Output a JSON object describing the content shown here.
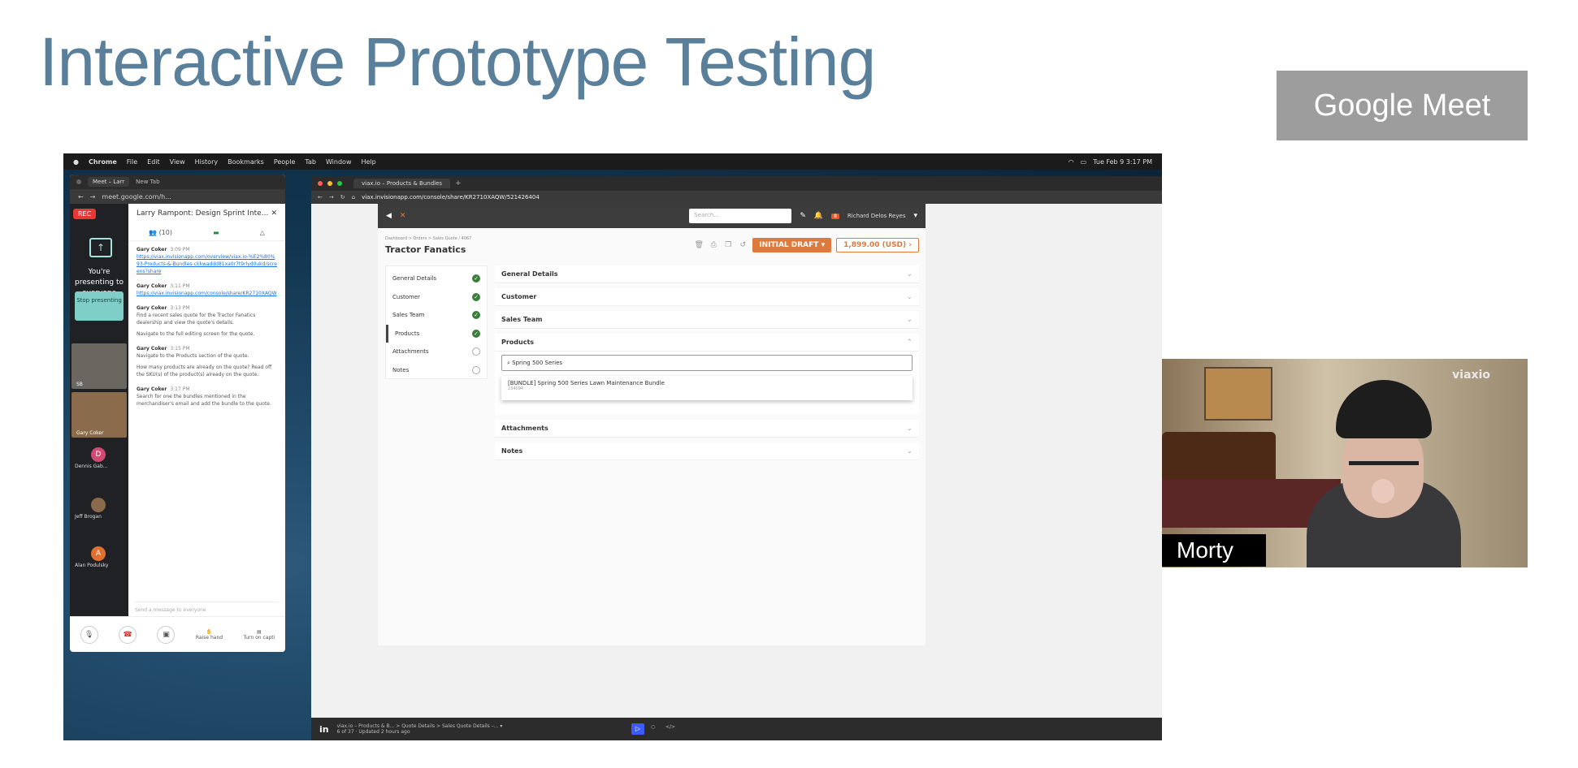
{
  "slide": {
    "title": "Interactive Prototype Testing",
    "badge": "Google Meet"
  },
  "mac_menu": {
    "items": [
      "Chrome",
      "File",
      "Edit",
      "View",
      "History",
      "Bookmarks",
      "People",
      "Tab",
      "Window",
      "Help"
    ],
    "clock": "Tue Feb 9 3:17 PM"
  },
  "meet": {
    "tab_label": "Meet – Larr",
    "new_tab": "New Tab",
    "url": "meet.google.com/h...",
    "rec": "REC",
    "presenting_text": "You're presenting to everyone",
    "stop_label": "Stop presenting",
    "chat_title": "Larry Rampont: Design Sprint Inte...",
    "participants_count": "(10)",
    "tiles": [
      {
        "name": "SB"
      },
      {
        "name": "Gary Coker"
      }
    ],
    "participants": [
      {
        "initial": "D",
        "name": "Dennis Gab...",
        "color": "#d14a72"
      },
      {
        "initial": "",
        "name": "Jeff Brogan",
        "color": "#8a6a4a"
      },
      {
        "initial": "A",
        "name": "Alan Podulsky",
        "color": "#e07030"
      }
    ],
    "messages": [
      {
        "who": "Gary Coker",
        "time": "3:09 PM",
        "text": "",
        "link": "https://viax.invisionapp.com/overview/viax.io-%E2%80%93-Products-&-Bundles-ckkwaddd81xa0r7t9rlyd0ukd/screens?share"
      },
      {
        "who": "Gary Coker",
        "time": "3:11 PM",
        "text": "",
        "link": "https://viax.invisionapp.com/console/share/KR2710XAQW"
      },
      {
        "who": "Gary Coker",
        "time": "3:13 PM",
        "text": "Find a recent sales quote for the Tractor Fanatics dealership and view the quote's details.",
        "text2": "Navigate to the full editing screen for the quote.",
        "link": ""
      },
      {
        "who": "Gary Coker",
        "time": "3:15 PM",
        "text": "Navigate to the Products section of the quote.",
        "text2": "How many products are already on the quote? Read off the SKU(s) of the product(s) already on the quote.",
        "link": ""
      },
      {
        "who": "Gary Coker",
        "time": "3:17 PM",
        "text": "Search for one the bundles mentioned in the merchandiser's email and add the bundle to the quote.",
        "link": ""
      }
    ],
    "input_placeholder": "Send a message to everyone",
    "controls": {
      "raise": "Raise hand",
      "captions": "Turn on capti"
    }
  },
  "browser": {
    "tab_label": "viax.io – Products & Bundles",
    "url": "viax.invisionapp.com/console/share/KR2710XAQW/521426404",
    "app": {
      "search_placeholder": "Search...",
      "bell_count": "8",
      "user": "Richard Delos Reyes",
      "breadcrumb": "Dashboard > Orders > Sales Quote / 4067",
      "page_title": "Tractor Fanatics",
      "status_button": "INITIAL DRAFT",
      "price_button": "1,899.00 (USD)",
      "steps": [
        {
          "label": "General Details",
          "done": true
        },
        {
          "label": "Customer",
          "done": true
        },
        {
          "label": "Sales Team",
          "done": true
        },
        {
          "label": "Products",
          "done": true,
          "active": true
        },
        {
          "label": "Attachments",
          "done": false
        },
        {
          "label": "Notes",
          "done": false
        }
      ],
      "sections_top": [
        "General Details",
        "Customer",
        "Sales Team",
        "Products"
      ],
      "sections_bottom": [
        "Attachments",
        "Notes"
      ],
      "product_search": "Spring 500 Series",
      "result_name": "[BUNDLE] Spring 500 Series Lawn Maintenance Bundle",
      "result_sku": "234094"
    },
    "invision": {
      "logo": "in",
      "breadcrumb": "viax.io – Products & B... > Quote Details > Sales Quote Details –... ▾",
      "meta": "6 of 37 · Updated 2 hours ago"
    }
  },
  "video": {
    "name": "Morty",
    "logo": "viaxio"
  }
}
